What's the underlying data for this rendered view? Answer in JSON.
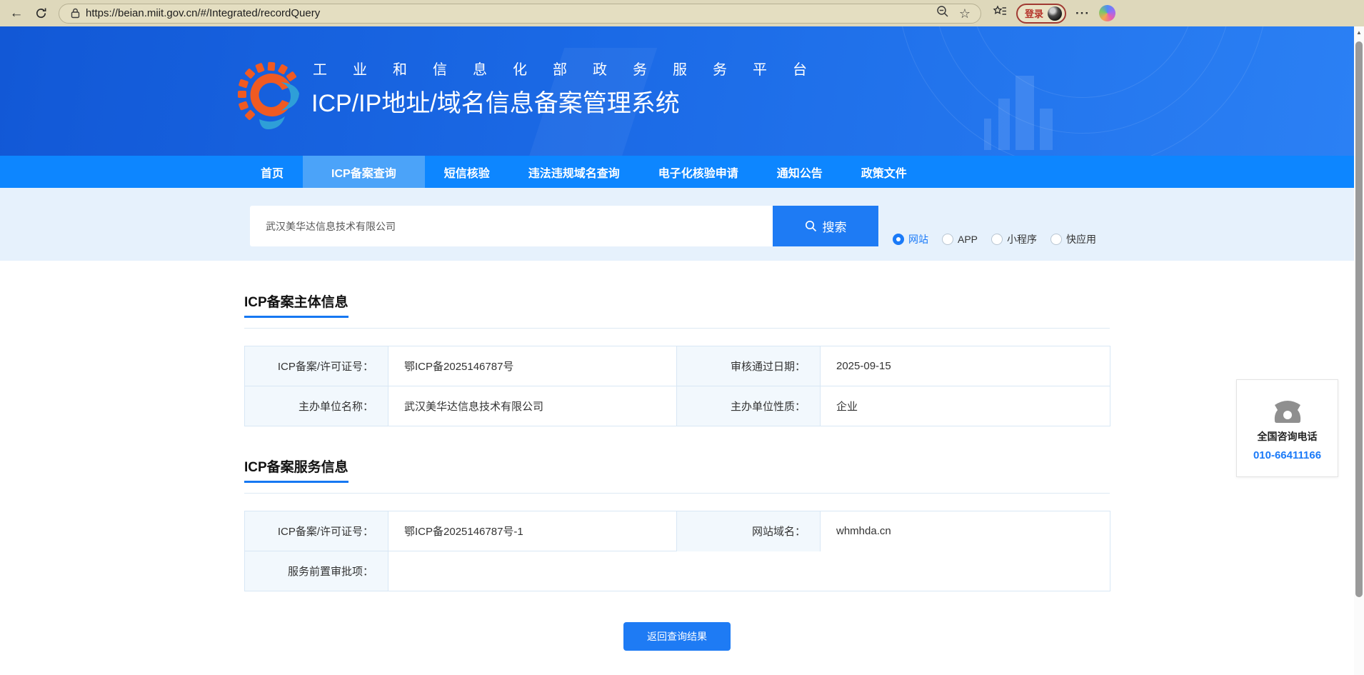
{
  "browser": {
    "url": "https://beian.miit.gov.cn/#/Integrated/recordQuery",
    "login_label": "登录",
    "dots_label": "···"
  },
  "header": {
    "subtitle": "工业和信息化部政务服务平台",
    "title": "ICP/IP地址/域名信息备案管理系统"
  },
  "nav": {
    "active": "ICP备案查询",
    "items": [
      "首页",
      "ICP备案查询",
      "短信核验",
      "违法违规域名查询",
      "电子化核验申请",
      "通知公告",
      "政策文件"
    ]
  },
  "search": {
    "value": "武汉美华达信息技术有限公司",
    "button_label": "搜索",
    "options": [
      {
        "label": "网站",
        "selected": true
      },
      {
        "label": "APP",
        "selected": false
      },
      {
        "label": "小程序",
        "selected": false
      },
      {
        "label": "快应用",
        "selected": false
      }
    ]
  },
  "subject_section": {
    "title": "ICP备案主体信息",
    "rows": [
      {
        "c0": "ICP备案/许可证号：",
        "v0": "鄂ICP备2025146787号",
        "c1": "审核通过日期：",
        "v1": "2025-09-15"
      },
      {
        "c0": "主办单位名称：",
        "v0": "武汉美华达信息技术有限公司",
        "c1": "主办单位性质：",
        "v1": "企业"
      }
    ]
  },
  "service_section": {
    "title": "ICP备案服务信息",
    "rows": [
      {
        "c0": "ICP备案/许可证号：",
        "v0": "鄂ICP备2025146787号-1",
        "c1": "网站域名：",
        "v1": "whmhda.cn"
      },
      {
        "c0": "服务前置审批项：",
        "v0": ""
      }
    ]
  },
  "contact": {
    "label": "全国咨询电话",
    "phone": "010-66411166"
  },
  "actions": {
    "back_button": "返回查询结果"
  },
  "colors": {
    "chrome_bg": "#ded8bb",
    "header_gradient_start": "#1258d6",
    "header_gradient_end": "#2b80f4",
    "nav_blue": "#0d86ff",
    "active_tab_blue": "#4ba3f9",
    "band_bg": "#e6f1fc",
    "primary_blue": "#1e7bf4",
    "link_blue": "#1a7af8",
    "table_label_bg": "#f2f8fd",
    "table_border": "#d8e7f5",
    "login_red": "#b5342b"
  }
}
